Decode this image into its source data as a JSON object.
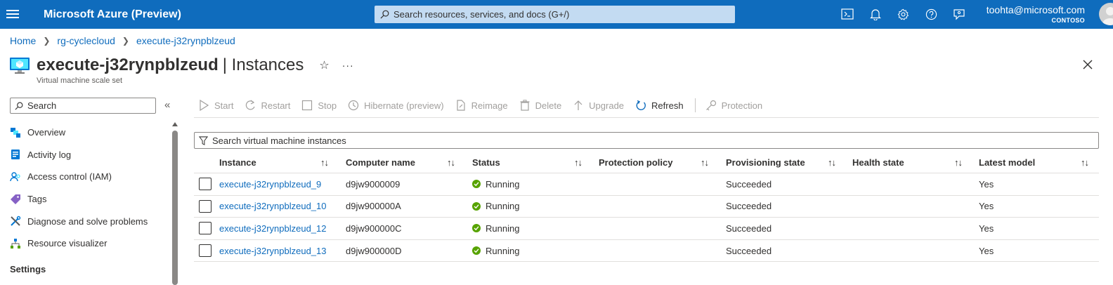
{
  "topbar": {
    "brand": "Microsoft Azure (Preview)",
    "search_placeholder": "Search resources, services, and docs (G+/)",
    "user_name": "toohta@microsoft.com",
    "tenant": "CONTOSO"
  },
  "breadcrumb": [
    "Home",
    "rg-cyclecloud",
    "execute-j32rynpblzeud"
  ],
  "page": {
    "resource_name": "execute-j32rynpblzeud",
    "blade_title": "| Instances",
    "subtitle": "Virtual machine scale set"
  },
  "sidebar": {
    "search_placeholder": "Search",
    "items": [
      {
        "label": "Overview",
        "icon": "overview-icon"
      },
      {
        "label": "Activity log",
        "icon": "activity-log-icon"
      },
      {
        "label": "Access control (IAM)",
        "icon": "iam-icon"
      },
      {
        "label": "Tags",
        "icon": "tag-icon"
      },
      {
        "label": "Diagnose and solve problems",
        "icon": "wrench-icon"
      },
      {
        "label": "Resource visualizer",
        "icon": "visualizer-icon"
      }
    ],
    "section_settings": "Settings"
  },
  "toolbar": {
    "start": "Start",
    "restart": "Restart",
    "stop": "Stop",
    "hibernate": "Hibernate (preview)",
    "reimage": "Reimage",
    "delete": "Delete",
    "upgrade": "Upgrade",
    "refresh": "Refresh",
    "protection": "Protection"
  },
  "filter_placeholder": "Search virtual machine instances",
  "table": {
    "columns": [
      "Instance",
      "Computer name",
      "Status",
      "Protection policy",
      "Provisioning state",
      "Health state",
      "Latest model"
    ],
    "rows": [
      {
        "instance": "execute-j32rynpblzeud_9",
        "computer": "d9jw9000009",
        "status": "Running",
        "protection": "",
        "provisioning": "Succeeded",
        "health": "",
        "latest": "Yes"
      },
      {
        "instance": "execute-j32rynpblzeud_10",
        "computer": "d9jw900000A",
        "status": "Running",
        "protection": "",
        "provisioning": "Succeeded",
        "health": "",
        "latest": "Yes"
      },
      {
        "instance": "execute-j32rynpblzeud_12",
        "computer": "d9jw900000C",
        "status": "Running",
        "protection": "",
        "provisioning": "Succeeded",
        "health": "",
        "latest": "Yes"
      },
      {
        "instance": "execute-j32rynpblzeud_13",
        "computer": "d9jw900000D",
        "status": "Running",
        "protection": "",
        "provisioning": "Succeeded",
        "health": "",
        "latest": "Yes"
      }
    ]
  },
  "colors": {
    "accent": "#0f6cbd",
    "running": "#57a300",
    "disabled": "#a19f9d"
  }
}
